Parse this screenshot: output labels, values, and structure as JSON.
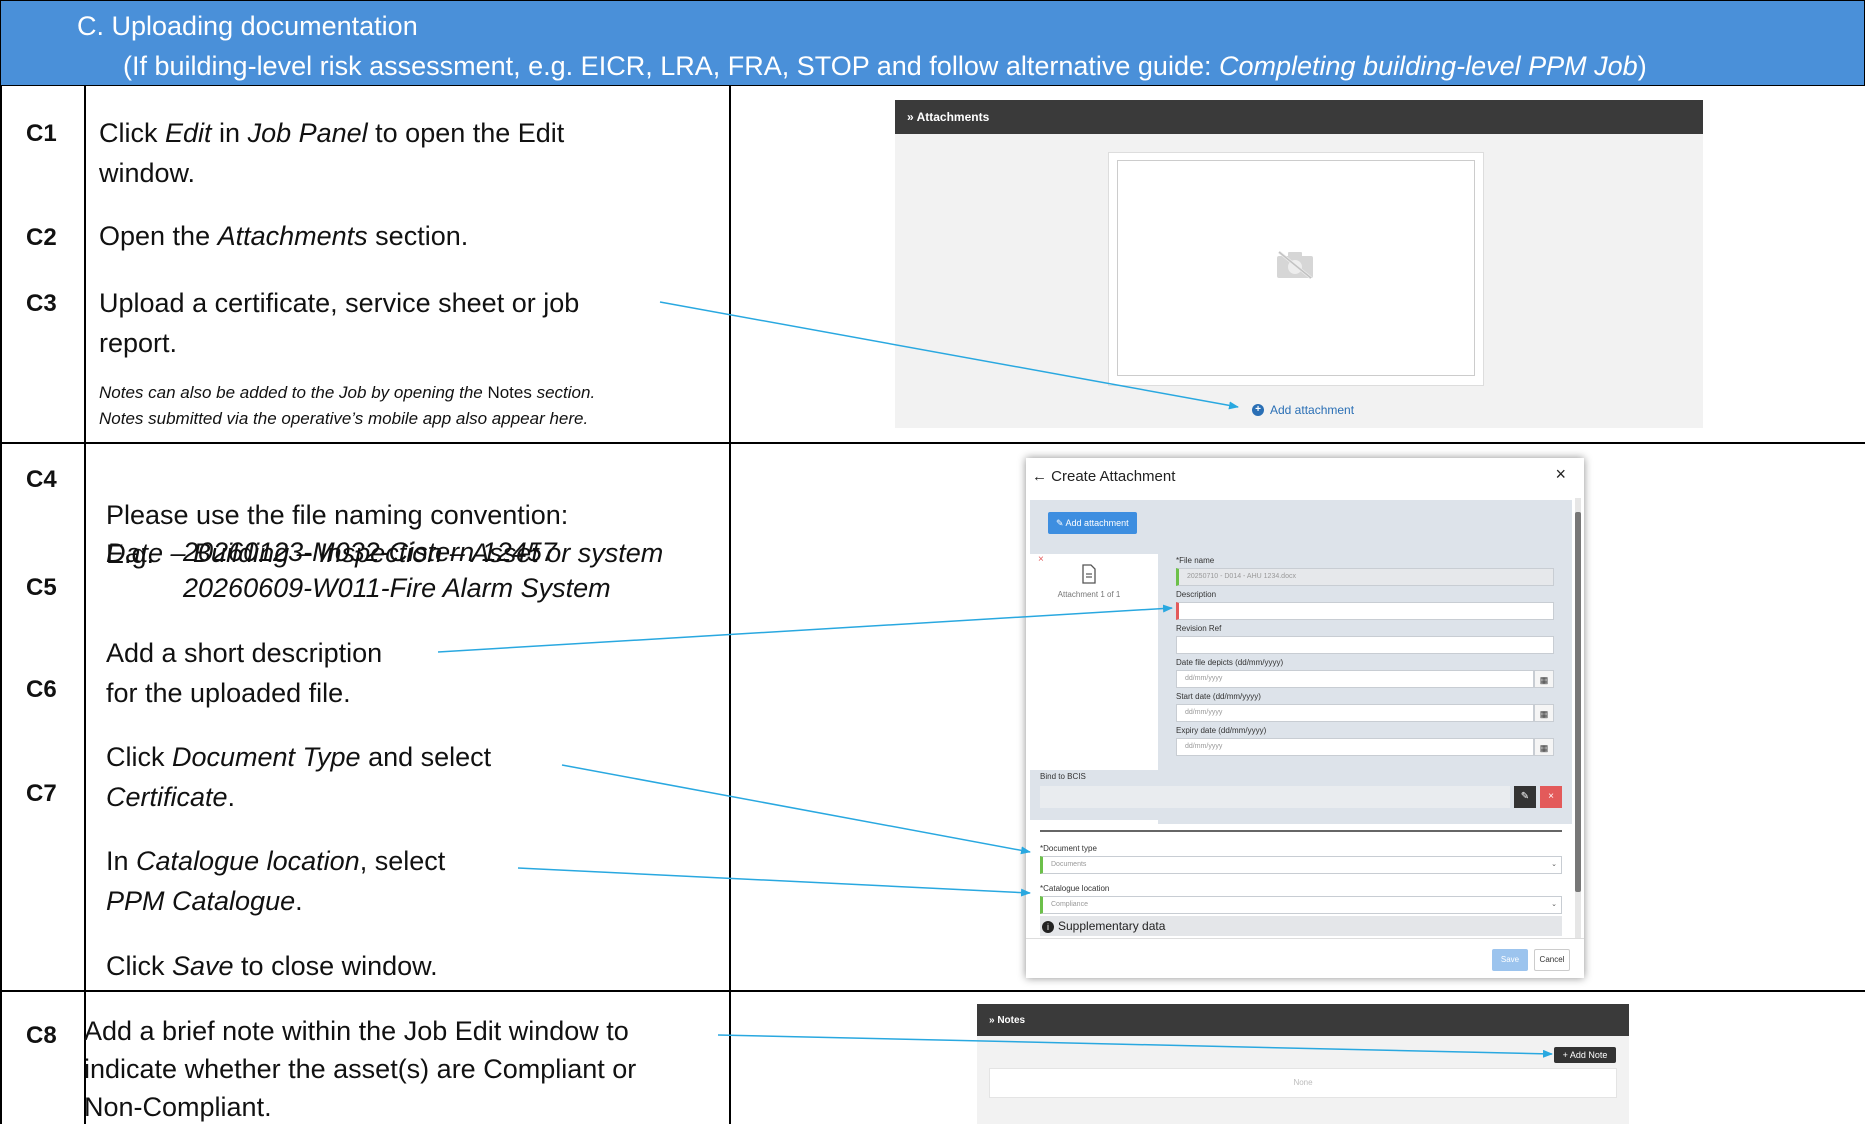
{
  "header": {
    "line1": "C.  Uploading documentation",
    "line2_pre": "(If building-level risk assessment, e.g. EICR, LRA, FRA, STOP and follow alternative guide: ",
    "line2_italic": "Completing building-level PPM Job",
    "line2_post": ")"
  },
  "steps": {
    "c1": "C1",
    "c2": "C2",
    "c3": "C3",
    "c4": "C4",
    "c5": "C5",
    "c6": "C6",
    "c7": "C7",
    "c8": "C8"
  },
  "text": {
    "c1_a": "Click ",
    "c1_b": "Edit",
    "c1_c": " in ",
    "c1_d": "Job Panel",
    "c1_e": " to open the Edit",
    "c1_f": "window.",
    "c2_a": "Open the ",
    "c2_b": "Attachments",
    "c2_c": " section.",
    "c3_a": "Upload a certificate, service sheet or job",
    "c3_b": "report.",
    "note_a": "Notes can also be added to the Job by opening the ",
    "note_b": "Notes",
    "note_c": " section.",
    "note_d": "Notes submitted via the operative’s mobile app also appear here.",
    "c4_a": "Please use the file naming convention:",
    "c4_b": "Date – Building – Inspection – Asset or system",
    "c4_c": "E.g.",
    "c4_d": "20260123-M032-Cistern 12457",
    "c4_e": "20260609-W011-Fire Alarm System",
    "c5_a": "Add a short description",
    "c5_b": "for the uploaded file.",
    "c6_a": "Click ",
    "c6_b": "Document Type",
    "c6_c": " and select",
    "c6_d": "Certificate",
    "c6_e": ".",
    "c7_a": "In ",
    "c7_b": "Catalogue location",
    "c7_c": ", select",
    "c7_d": "PPM Catalogue",
    "c7_e": ".",
    "save_a": "Click ",
    "save_b": "Save",
    "save_c": " to close window.",
    "c8_a": "Add a brief note within the Job Edit window to",
    "c8_b": "indicate whether the asset(s) are Compliant or",
    "c8_c": "Non-Compliant."
  },
  "attachments_panel": {
    "title": "» Attachments",
    "add_label": "Add attachment"
  },
  "dialog": {
    "title": "Create Attachment",
    "close": "×",
    "add_button": "Add attachment",
    "attachment_counter": "Attachment 1 of 1",
    "remove_mark": "×",
    "file_name_label": "*File name",
    "file_name_value": "20250710 - D014 - AHU 1234.docx",
    "description_label": "Description",
    "revision_label": "Revision Ref",
    "date_depicts_label": "Date file depicts (dd/mm/yyyy)",
    "start_date_label": "Start date (dd/mm/yyyy)",
    "expiry_date_label": "Expiry date (dd/mm/yyyy)",
    "date_placeholder": "dd/mm/yyyy",
    "bind_label": "Bind to BCIS",
    "doc_type_label": "*Document type",
    "doc_type_value": "Documents",
    "catalogue_label": "*Catalogue location",
    "catalogue_value": "Compliance",
    "supplementary": "Supplementary data",
    "save": "Save",
    "cancel": "Cancel"
  },
  "notes_panel": {
    "title": "» Notes",
    "add_note": "+ Add Note",
    "empty": "None"
  },
  "colors": {
    "header_bg": "#4a90d9",
    "arrow": "#29a8e0",
    "accent_blue": "#3d8ee0",
    "valid_green": "#6cc04a",
    "invalid_red": "#e35a5a"
  }
}
